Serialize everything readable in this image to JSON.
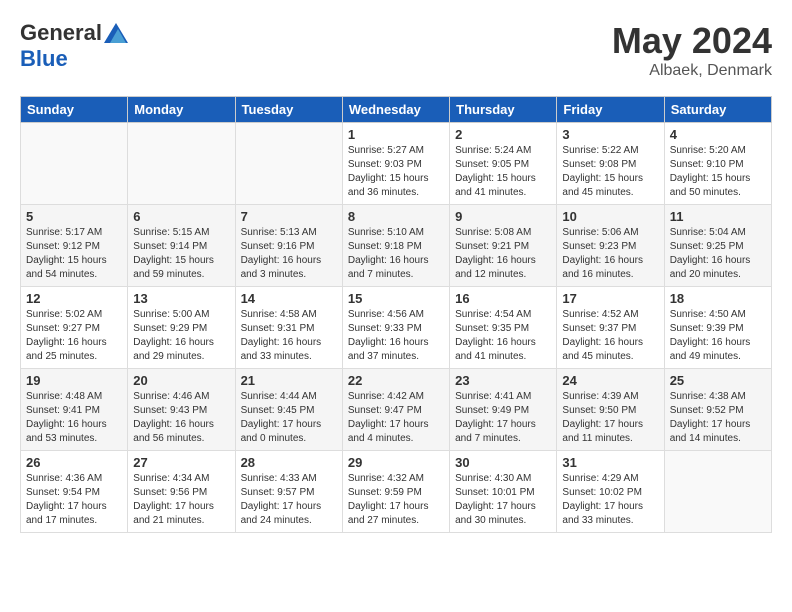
{
  "header": {
    "logo_general": "General",
    "logo_blue": "Blue",
    "month": "May 2024",
    "location": "Albaek, Denmark"
  },
  "weekdays": [
    "Sunday",
    "Monday",
    "Tuesday",
    "Wednesday",
    "Thursday",
    "Friday",
    "Saturday"
  ],
  "weeks": [
    [
      {
        "day": "",
        "info": ""
      },
      {
        "day": "",
        "info": ""
      },
      {
        "day": "",
        "info": ""
      },
      {
        "day": "1",
        "info": "Sunrise: 5:27 AM\nSunset: 9:03 PM\nDaylight: 15 hours\nand 36 minutes."
      },
      {
        "day": "2",
        "info": "Sunrise: 5:24 AM\nSunset: 9:05 PM\nDaylight: 15 hours\nand 41 minutes."
      },
      {
        "day": "3",
        "info": "Sunrise: 5:22 AM\nSunset: 9:08 PM\nDaylight: 15 hours\nand 45 minutes."
      },
      {
        "day": "4",
        "info": "Sunrise: 5:20 AM\nSunset: 9:10 PM\nDaylight: 15 hours\nand 50 minutes."
      }
    ],
    [
      {
        "day": "5",
        "info": "Sunrise: 5:17 AM\nSunset: 9:12 PM\nDaylight: 15 hours\nand 54 minutes."
      },
      {
        "day": "6",
        "info": "Sunrise: 5:15 AM\nSunset: 9:14 PM\nDaylight: 15 hours\nand 59 minutes."
      },
      {
        "day": "7",
        "info": "Sunrise: 5:13 AM\nSunset: 9:16 PM\nDaylight: 16 hours\nand 3 minutes."
      },
      {
        "day": "8",
        "info": "Sunrise: 5:10 AM\nSunset: 9:18 PM\nDaylight: 16 hours\nand 7 minutes."
      },
      {
        "day": "9",
        "info": "Sunrise: 5:08 AM\nSunset: 9:21 PM\nDaylight: 16 hours\nand 12 minutes."
      },
      {
        "day": "10",
        "info": "Sunrise: 5:06 AM\nSunset: 9:23 PM\nDaylight: 16 hours\nand 16 minutes."
      },
      {
        "day": "11",
        "info": "Sunrise: 5:04 AM\nSunset: 9:25 PM\nDaylight: 16 hours\nand 20 minutes."
      }
    ],
    [
      {
        "day": "12",
        "info": "Sunrise: 5:02 AM\nSunset: 9:27 PM\nDaylight: 16 hours\nand 25 minutes."
      },
      {
        "day": "13",
        "info": "Sunrise: 5:00 AM\nSunset: 9:29 PM\nDaylight: 16 hours\nand 29 minutes."
      },
      {
        "day": "14",
        "info": "Sunrise: 4:58 AM\nSunset: 9:31 PM\nDaylight: 16 hours\nand 33 minutes."
      },
      {
        "day": "15",
        "info": "Sunrise: 4:56 AM\nSunset: 9:33 PM\nDaylight: 16 hours\nand 37 minutes."
      },
      {
        "day": "16",
        "info": "Sunrise: 4:54 AM\nSunset: 9:35 PM\nDaylight: 16 hours\nand 41 minutes."
      },
      {
        "day": "17",
        "info": "Sunrise: 4:52 AM\nSunset: 9:37 PM\nDaylight: 16 hours\nand 45 minutes."
      },
      {
        "day": "18",
        "info": "Sunrise: 4:50 AM\nSunset: 9:39 PM\nDaylight: 16 hours\nand 49 minutes."
      }
    ],
    [
      {
        "day": "19",
        "info": "Sunrise: 4:48 AM\nSunset: 9:41 PM\nDaylight: 16 hours\nand 53 minutes."
      },
      {
        "day": "20",
        "info": "Sunrise: 4:46 AM\nSunset: 9:43 PM\nDaylight: 16 hours\nand 56 minutes."
      },
      {
        "day": "21",
        "info": "Sunrise: 4:44 AM\nSunset: 9:45 PM\nDaylight: 17 hours\nand 0 minutes."
      },
      {
        "day": "22",
        "info": "Sunrise: 4:42 AM\nSunset: 9:47 PM\nDaylight: 17 hours\nand 4 minutes."
      },
      {
        "day": "23",
        "info": "Sunrise: 4:41 AM\nSunset: 9:49 PM\nDaylight: 17 hours\nand 7 minutes."
      },
      {
        "day": "24",
        "info": "Sunrise: 4:39 AM\nSunset: 9:50 PM\nDaylight: 17 hours\nand 11 minutes."
      },
      {
        "day": "25",
        "info": "Sunrise: 4:38 AM\nSunset: 9:52 PM\nDaylight: 17 hours\nand 14 minutes."
      }
    ],
    [
      {
        "day": "26",
        "info": "Sunrise: 4:36 AM\nSunset: 9:54 PM\nDaylight: 17 hours\nand 17 minutes."
      },
      {
        "day": "27",
        "info": "Sunrise: 4:34 AM\nSunset: 9:56 PM\nDaylight: 17 hours\nand 21 minutes."
      },
      {
        "day": "28",
        "info": "Sunrise: 4:33 AM\nSunset: 9:57 PM\nDaylight: 17 hours\nand 24 minutes."
      },
      {
        "day": "29",
        "info": "Sunrise: 4:32 AM\nSunset: 9:59 PM\nDaylight: 17 hours\nand 27 minutes."
      },
      {
        "day": "30",
        "info": "Sunrise: 4:30 AM\nSunset: 10:01 PM\nDaylight: 17 hours\nand 30 minutes."
      },
      {
        "day": "31",
        "info": "Sunrise: 4:29 AM\nSunset: 10:02 PM\nDaylight: 17 hours\nand 33 minutes."
      },
      {
        "day": "",
        "info": ""
      }
    ]
  ]
}
